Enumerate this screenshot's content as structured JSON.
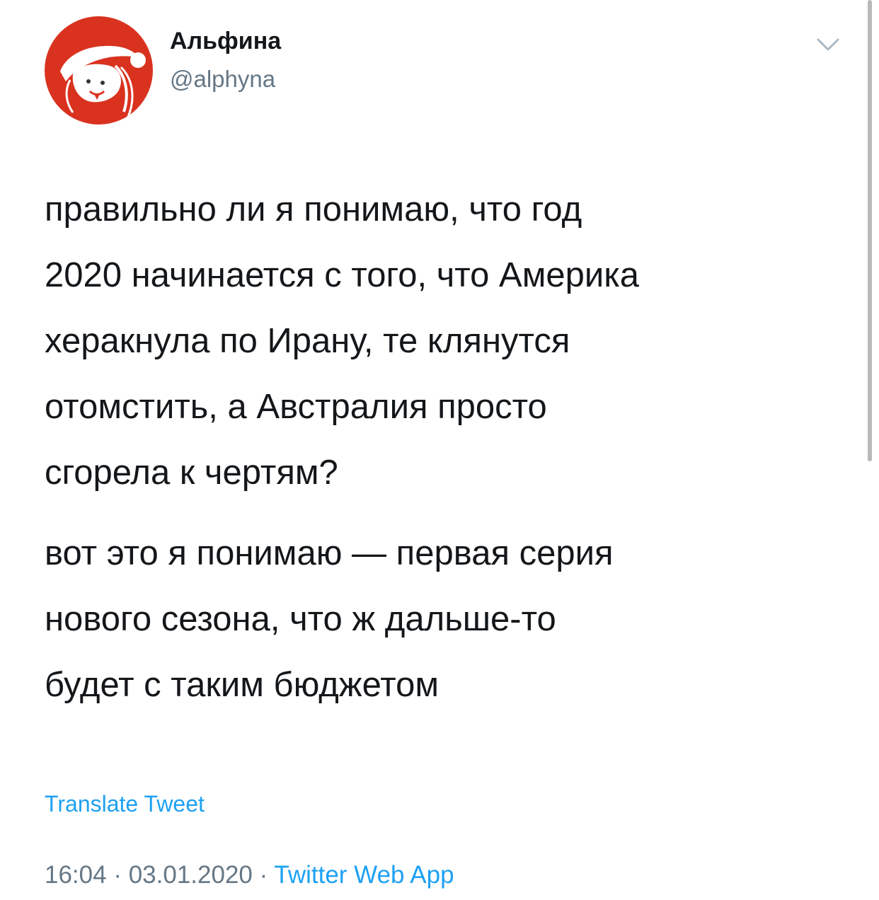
{
  "author": {
    "display_name": "Альфина",
    "handle": "@alphyna",
    "avatar_icon": "santa-hat-character-avatar"
  },
  "menu": {
    "icon": "chevron-down-icon"
  },
  "tweet": {
    "paragraph1": [
      "правильно ли я понимаю, что год",
      "2020 начинается с того, что Америка",
      "херакнула по Ирану, те клянутся",
      "отомстить, а Австралия просто",
      "сгорела к чертям?"
    ],
    "paragraph2": [
      "вот это я понимаю — первая серия",
      "нового сезона, что ж дальше-то",
      "будет с таким бюджетом"
    ]
  },
  "translate_label": "Translate Tweet",
  "meta": {
    "time": "16:04",
    "separator": "·",
    "date": "03.01.2020",
    "source": "Twitter Web App"
  },
  "colors": {
    "accent": "#1da1f2",
    "secondary_text": "#657786",
    "primary_text": "#14171a",
    "avatar_background": "#d9321f"
  }
}
